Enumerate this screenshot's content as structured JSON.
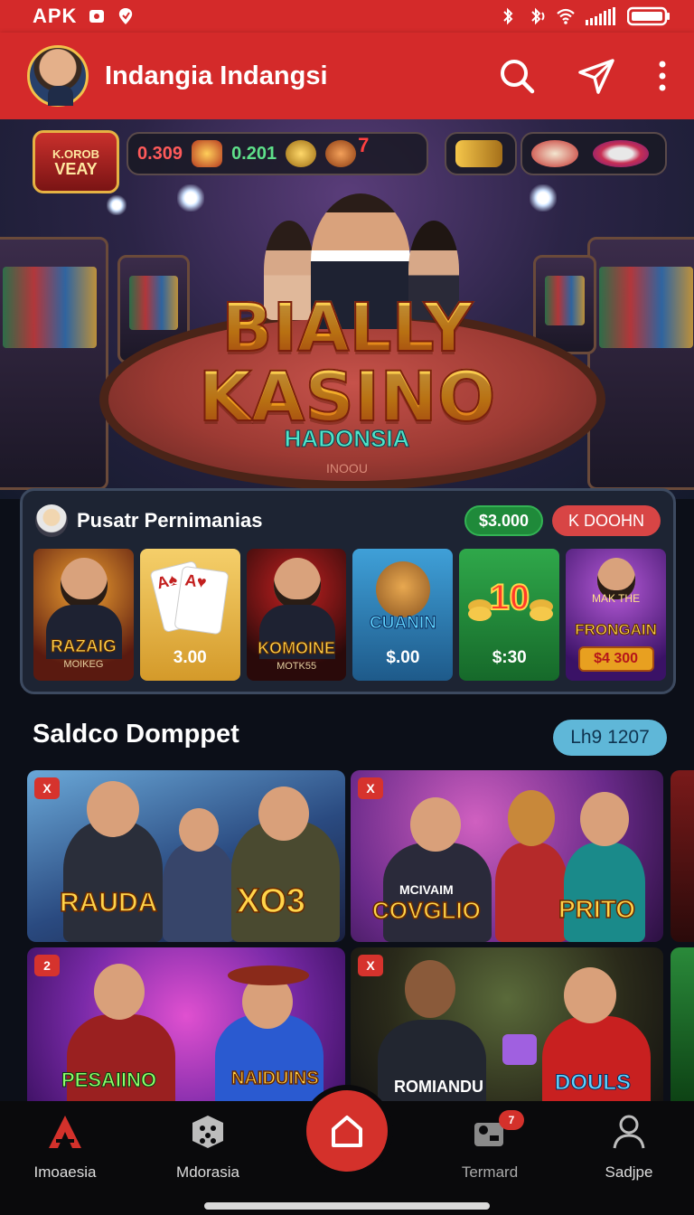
{
  "status_bar": {
    "carrier": "APK"
  },
  "app_bar": {
    "title": "Indangia Indangsi"
  },
  "hero": {
    "badge_line1": "K.OROB",
    "badge_line2": "VEAY",
    "hud_value_1": "0.309",
    "hud_value_2": "0.201",
    "hud_badge": "7",
    "title_line1": "BIALLY",
    "title_line2": "KASINO",
    "subtitle": "HADONSIA",
    "table_text": "INOOU"
  },
  "game_center": {
    "title": "Pusatr Pernimanias",
    "balance": "$3.000",
    "action_label": "K DOOHN",
    "games": [
      {
        "name": "RAZAIG",
        "sub": "MOIKEG",
        "price": ""
      },
      {
        "name": "",
        "sub": "",
        "price": "3.00"
      },
      {
        "name": "KOMOINE",
        "sub": "MOTK55",
        "price": ""
      },
      {
        "name": "CUANIN",
        "sub": "",
        "price": "$.00"
      },
      {
        "name": "10",
        "sub": "",
        "price": "$:30"
      },
      {
        "name": "FRONGAIN",
        "sub": "MAK THE",
        "price": "$4 300"
      }
    ]
  },
  "wallet": {
    "title": "Saldco Domppet",
    "pill": "Lh9 1207",
    "promos": [
      {
        "tag": "X",
        "name_left": "RAUDA",
        "name_right": "XO3"
      },
      {
        "tag": "X",
        "name_left": "COVGLIO",
        "name_top": "MCIVAIM",
        "name_right": "PRITO"
      },
      {
        "tag": "2",
        "name_left": "PESAIINO",
        "name_right": "NAIDUINS"
      },
      {
        "tag": "X",
        "name_left": "ROMIANDU",
        "name_right": "DOULS"
      }
    ]
  },
  "bottom_nav": {
    "items": [
      {
        "label": "Imoaesia"
      },
      {
        "label": "Mdorasia"
      },
      {
        "label": "Termard"
      },
      {
        "label": "Sadjpe"
      }
    ],
    "notification_count": "7"
  },
  "colors": {
    "brand_red": "#d42a2a",
    "gold": "#f0a21c",
    "teal": "#4fe3c8"
  }
}
